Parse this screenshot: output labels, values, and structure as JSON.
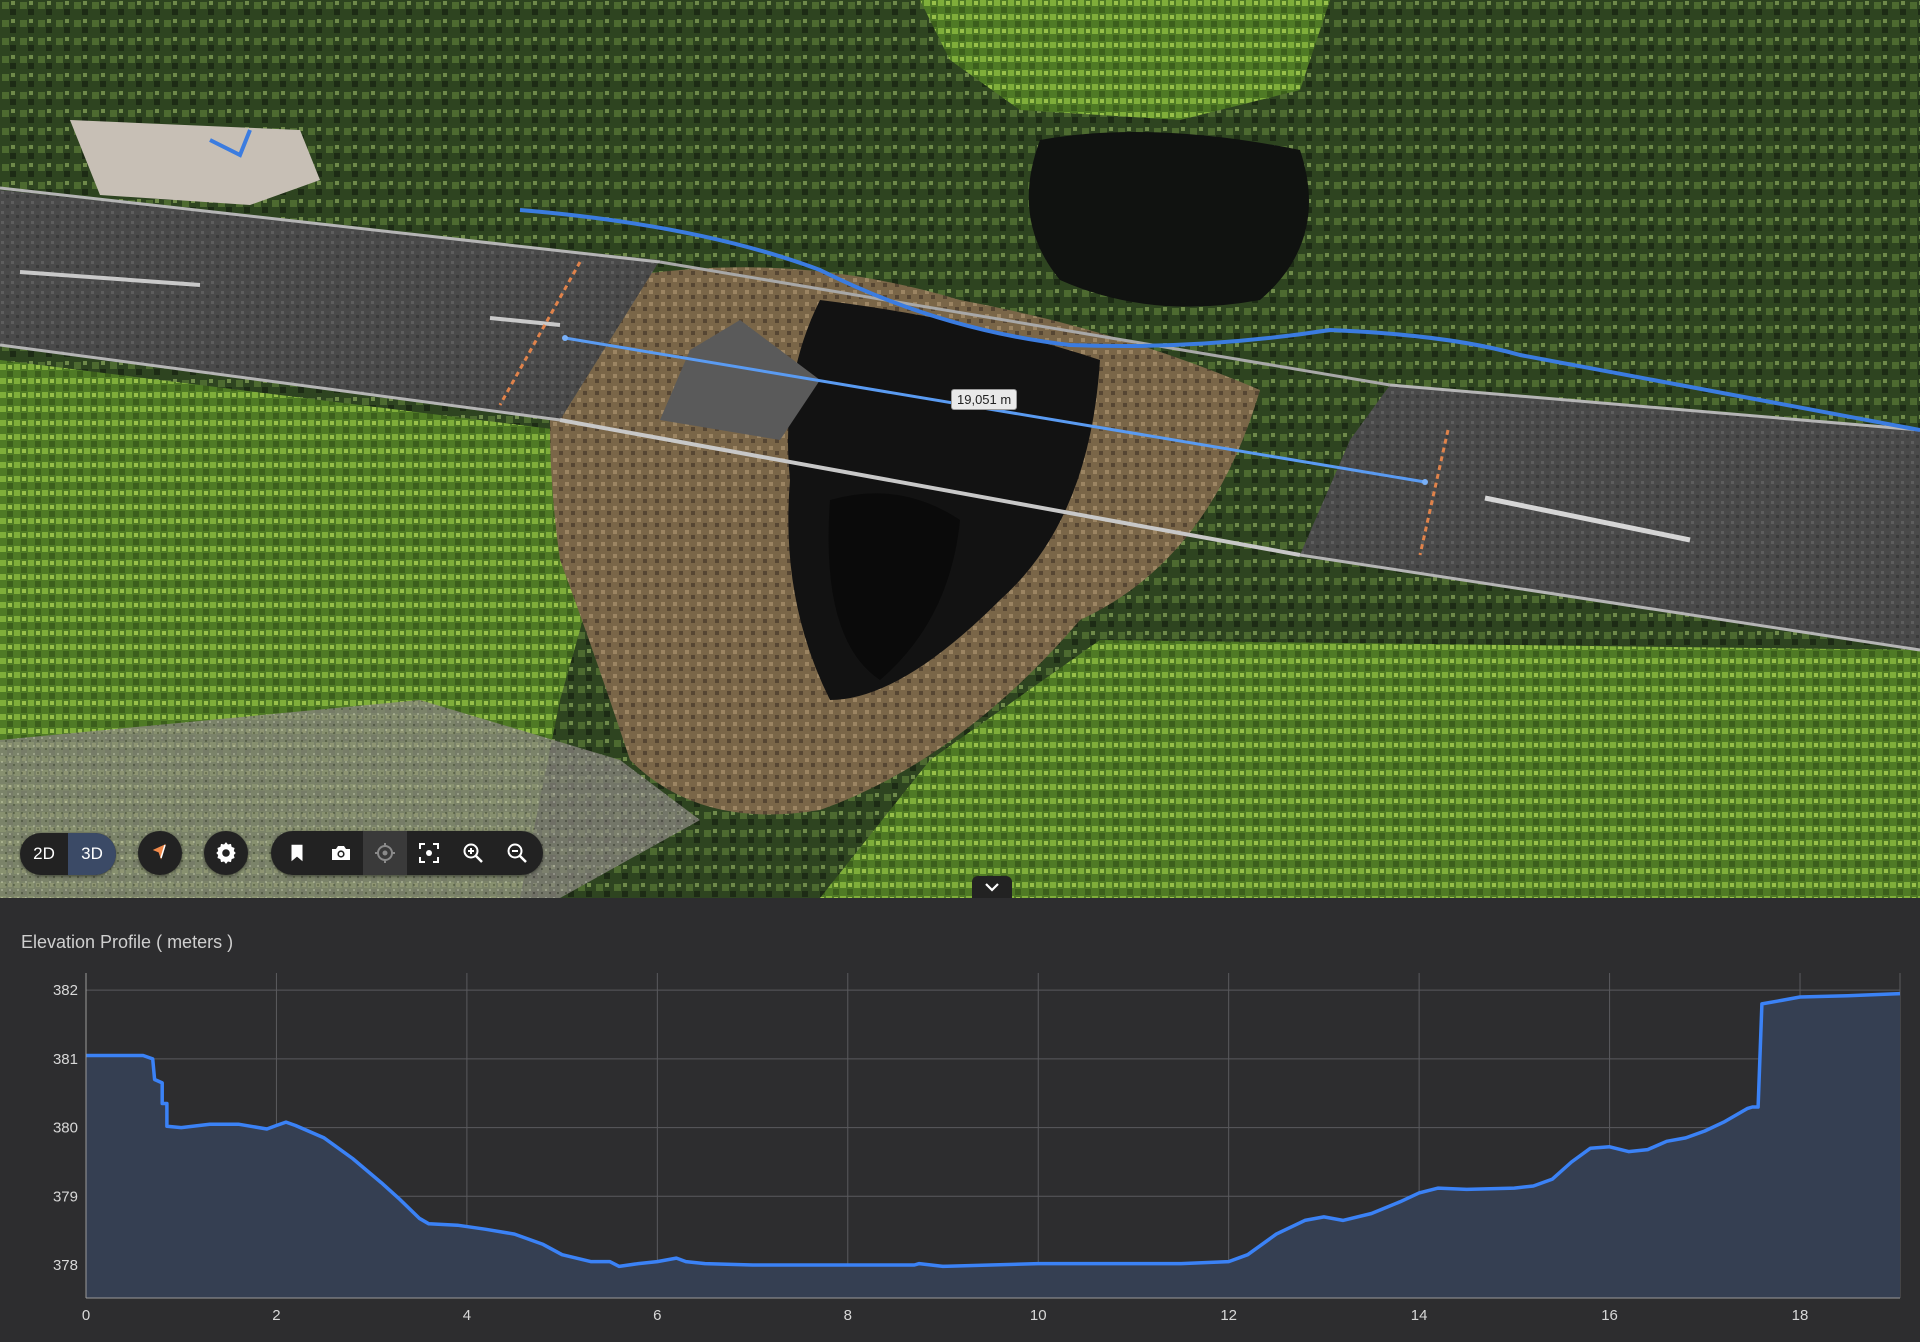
{
  "viewer": {
    "measurement_label": "19,051 m",
    "mode_2d": "2D",
    "mode_3d": "3D",
    "active_mode": "3D",
    "icons": [
      "cursor-icon",
      "gear-icon",
      "bookmark-icon",
      "camera-icon",
      "crosshair-icon",
      "focus-icon",
      "zoom-in-icon",
      "zoom-out-icon",
      "chevron-down-icon"
    ]
  },
  "profile": {
    "title": "Elevation Profile ( meters )"
  },
  "colors": {
    "line": "#3b82f6",
    "fill": "#353f52",
    "panel": "#2d2d2f",
    "grid": "#5a5a5e"
  },
  "chart_data": {
    "type": "area",
    "title": "Elevation Profile ( meters )",
    "xlabel": "",
    "ylabel": "",
    "xlim": [
      0,
      19.05
    ],
    "ylim": [
      377.52,
      382.25
    ],
    "xticks": [
      0,
      2,
      4,
      6,
      8,
      10,
      12,
      14,
      16,
      18
    ],
    "yticks": [
      378,
      379,
      380,
      381,
      382
    ],
    "grid": true,
    "series": [
      {
        "x": [
          0,
          0.6,
          0.7,
          0.72,
          0.8,
          0.8,
          0.85,
          0.85,
          1.0,
          1.3,
          1.6,
          1.9,
          2.0,
          2.1,
          2.2,
          2.5,
          2.8,
          3.1,
          3.3,
          3.5,
          3.6,
          3.9,
          4.2,
          4.5,
          4.8,
          5.0,
          5.3,
          5.5,
          5.6,
          5.8,
          6.0,
          6.2,
          6.3,
          6.5,
          7.0,
          7.5,
          8.0,
          8.5,
          8.7,
          8.75,
          9.0,
          9.5,
          10.0,
          10.5,
          11.0,
          11.5,
          12.0,
          12.2,
          12.5,
          12.8,
          13.0,
          13.2,
          13.5,
          13.8,
          14.0,
          14.2,
          14.5,
          15.0,
          15.2,
          15.4,
          15.6,
          15.8,
          16.0,
          16.2,
          16.4,
          16.6,
          16.8,
          17.0,
          17.2,
          17.45,
          17.5,
          17.56,
          17.6,
          17.8,
          18.0,
          18.5,
          19.05
        ],
        "y": [
          381.05,
          381.05,
          381.0,
          380.7,
          380.65,
          380.35,
          380.35,
          380.02,
          380.0,
          380.05,
          380.05,
          379.98,
          380.03,
          380.08,
          380.03,
          379.85,
          379.55,
          379.2,
          378.95,
          378.68,
          378.6,
          378.58,
          378.52,
          378.45,
          378.3,
          378.15,
          378.05,
          378.05,
          377.98,
          378.02,
          378.05,
          378.1,
          378.05,
          378.02,
          378.0,
          378.0,
          378.0,
          378.0,
          378.0,
          378.02,
          377.98,
          378.0,
          378.02,
          378.02,
          378.02,
          378.02,
          378.05,
          378.15,
          378.45,
          378.65,
          378.7,
          378.65,
          378.75,
          378.92,
          379.05,
          379.12,
          379.1,
          379.12,
          379.15,
          379.25,
          379.5,
          379.7,
          379.72,
          379.65,
          379.68,
          379.8,
          379.85,
          379.95,
          380.08,
          380.28,
          380.3,
          380.3,
          381.8,
          381.85,
          381.9,
          381.92,
          381.95
        ]
      }
    ]
  }
}
